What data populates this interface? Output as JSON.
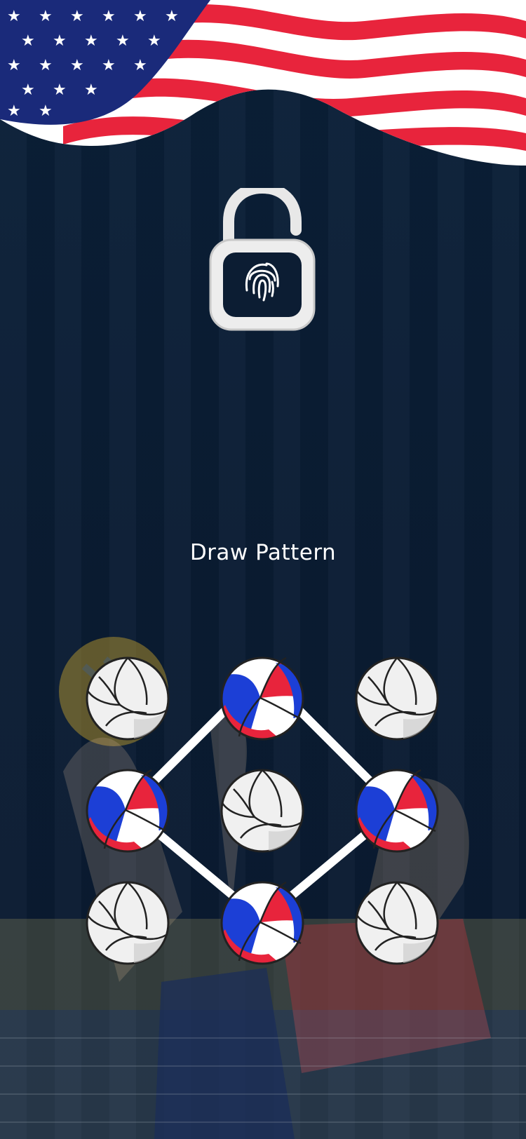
{
  "screen": {
    "title": "Draw Pattern"
  },
  "icons": {
    "lock": "open-padlock-fingerprint-icon",
    "flag": "us-flag-banner"
  },
  "pattern": {
    "grid": [
      "0-0",
      "0-1",
      "0-2",
      "1-0",
      "1-1",
      "1-2",
      "2-0",
      "2-1",
      "2-2"
    ],
    "selected": [
      "1-0",
      "0-1",
      "1-2",
      "2-1"
    ]
  },
  "colors": {
    "background": "#0a1a2e",
    "accent_red": "#e8243c",
    "accent_blue": "#1c3fd6",
    "ball_white": "#f0f0f0",
    "line": "#ffffff"
  }
}
